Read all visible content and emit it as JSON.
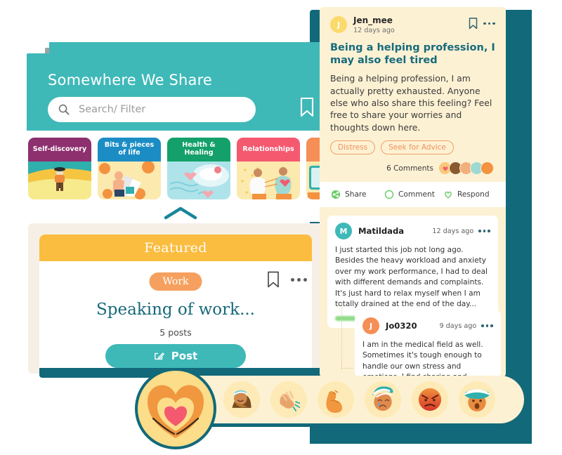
{
  "app": {
    "title": "Somewhere We Share",
    "theme": {
      "teal": "#3fb8b8",
      "dark_teal": "#12697a",
      "cream": "#fdf1d4",
      "amber": "#fabd40",
      "orange": "#f5a05e",
      "heading_teal": "#166b7c"
    }
  },
  "left_phone": {
    "header": {
      "title": "Somewhere We Share",
      "search_placeholder": "Search/ Filter",
      "search_value": "",
      "search_icon": "search-icon",
      "bookmark_icon": "bookmark-icon"
    },
    "categories": [
      {
        "label": "Self-discovery",
        "color": "#8e2f6e"
      },
      {
        "label": "Bits & pieces of life",
        "color": "#1b8dc4"
      },
      {
        "label": "Health & Healing",
        "color": "#14a06a"
      },
      {
        "label": "Relationships",
        "color": "#f4596f"
      },
      {
        "label": "",
        "color": "#f58f56"
      }
    ],
    "collapse_icon": "chevron-up-icon",
    "featured": {
      "section_title": "Featured",
      "tag": "Work",
      "title": "Speaking of work...",
      "post_count": "5 posts",
      "post_button": "Post",
      "post_button_icon": "pencil-square-icon",
      "bookmark_icon": "bookmark-icon",
      "more_icon": "more-options-icon"
    }
  },
  "right_phone": {
    "post": {
      "author": "Jen_mee",
      "author_initial": "J",
      "time": "12 days ago",
      "bookmark_icon": "bookmark-icon",
      "more_icon": "more-options-icon",
      "headline": "Being a helping profession, I may also feel tired",
      "body": "Being a helping profession, I am actually pretty exhausted. Anyone else who also share this feeling? Feel free to share your worries and thoughts down here.",
      "tags": [
        "Distress",
        "Seek for Advice"
      ],
      "comment_count": "6 Comments",
      "reaction_pile": [
        "heart-hands-emoji",
        "facepalm-emoji",
        "clap-emoji",
        "flex-emoji",
        "sad-emoji"
      ]
    },
    "actions": [
      {
        "label": "Share",
        "icon": "share-icon"
      },
      {
        "label": "Comment",
        "icon": "comment-icon"
      },
      {
        "label": "Respond",
        "icon": "heart-outline-icon"
      }
    ],
    "comments": [
      {
        "author": "Matildada",
        "author_initial": "M",
        "time": "12 days ago",
        "text": "I just started this job not long ago. Besides the heavy workload and anxiety over my work performance, I had to deal with different demands and complaints. It's just hard to relax myself when I am totally drained at the end of the day...",
        "more_icon": "more-options-icon",
        "reply_icon": "reply-arrow-icon",
        "like_icon": "heart-filled-icon"
      },
      {
        "author": "Jo0320",
        "author_initial": "J",
        "time": "9 days ago",
        "text": "I am in the medical field as well. Sometimes it's tough enough to handle our own stress and emotions. I find sharing and talking to teammates about my struggles quite important",
        "more_icon": "more-options-icon"
      }
    ]
  },
  "reaction_bar": {
    "primary": {
      "name": "heart-hands-reaction",
      "label": "heart-hands"
    },
    "items": [
      {
        "name": "facepalm-reaction",
        "label": "facepalm"
      },
      {
        "name": "clap-reaction",
        "label": "clap"
      },
      {
        "name": "flex-reaction",
        "label": "flex"
      },
      {
        "name": "crying-reaction",
        "label": "crying"
      },
      {
        "name": "angry-reaction",
        "label": "angry"
      },
      {
        "name": "shocked-reaction",
        "label": "shocked"
      }
    ]
  }
}
